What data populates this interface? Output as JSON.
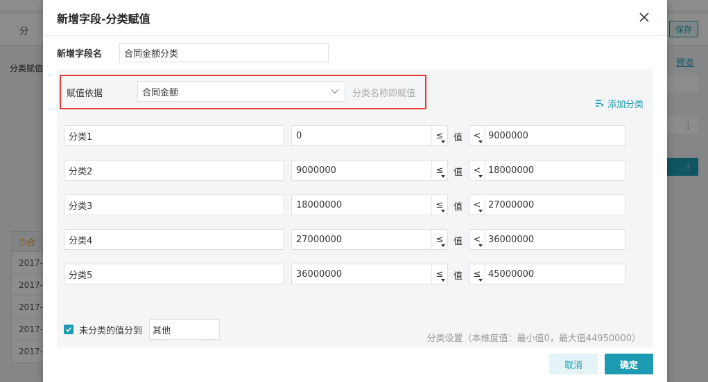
{
  "background": {
    "left_tab": "分",
    "save_label": "保存",
    "side_label": "分类赋值",
    "preview_label": "预览",
    "more_icon": "⋮",
    "table_head": "合",
    "table_cells": [
      "2017-",
      "2017-",
      "2017-",
      "2017-",
      "2017-"
    ]
  },
  "dialog": {
    "title": "新增字段-分类赋值",
    "field_name_label": "新增字段名",
    "field_name_value": "合同金额分类",
    "basis_label": "赋值依据",
    "basis_value": "合同金额",
    "basis_hint": "分类名称即赋值",
    "add_category_label": "添加分类",
    "value_label": "值",
    "categories": [
      {
        "name": "分类1",
        "min": "0",
        "op1": "≤",
        "op2": "<",
        "max": "9000000"
      },
      {
        "name": "分类2",
        "min": "9000000",
        "op1": "≤",
        "op2": "<",
        "max": "18000000"
      },
      {
        "name": "分类3",
        "min": "18000000",
        "op1": "≤",
        "op2": "<",
        "max": "27000000"
      },
      {
        "name": "分类4",
        "min": "27000000",
        "op1": "≤",
        "op2": "<",
        "max": "36000000"
      },
      {
        "name": "分类5",
        "min": "36000000",
        "op1": "≤",
        "op2": "≤",
        "max": "45000000"
      }
    ],
    "uncategorized_checked": true,
    "uncategorized_label": "未分类的值分到",
    "uncategorized_value": "其他",
    "stats_text": "分类设置（本维度值：最小值0，最大值44950000）",
    "cancel_label": "取消",
    "ok_label": "确定"
  },
  "colors": {
    "accent": "#1d9bb3",
    "highlight_border": "#e53935"
  }
}
